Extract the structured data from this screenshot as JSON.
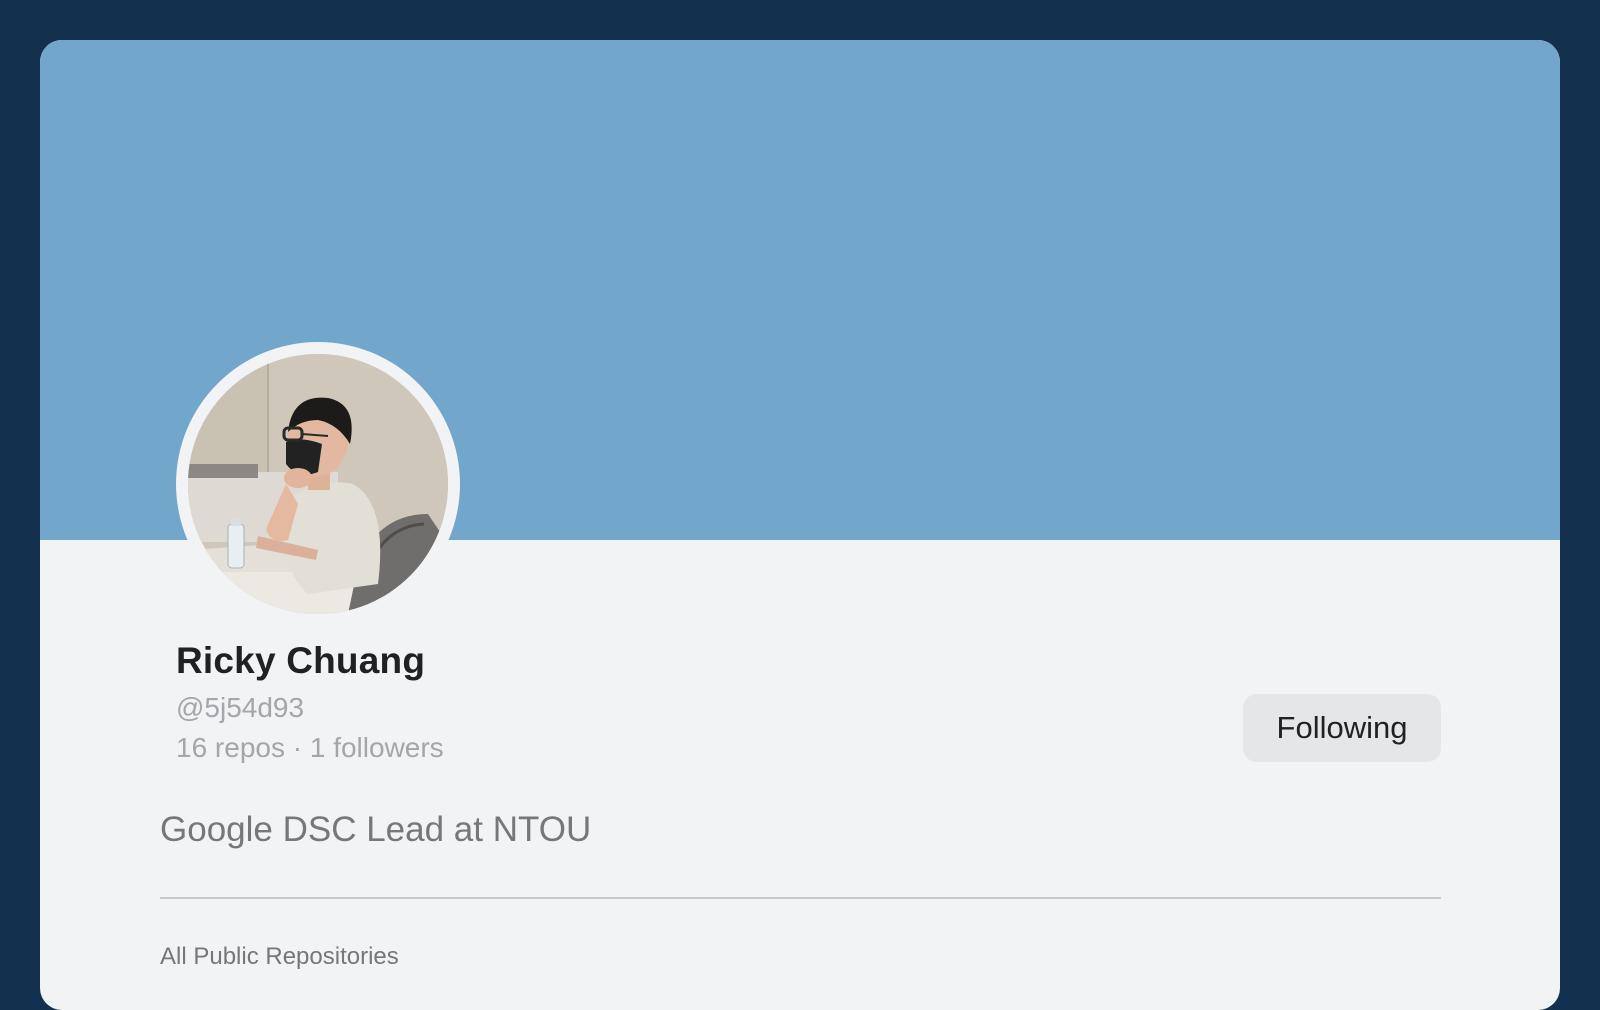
{
  "profile": {
    "name": "Ricky Chuang",
    "handle": "@5j54d93",
    "stats": "16 repos · 1 followers",
    "bio": "Google DSC Lead at NTOU",
    "follow_label": "Following"
  },
  "repositories": {
    "section_title": "All Public Repositories"
  },
  "colors": {
    "page_background": "#13304f",
    "banner": "#72a7cb",
    "card": "#f2f3f5",
    "button": "#e5e6e8"
  }
}
